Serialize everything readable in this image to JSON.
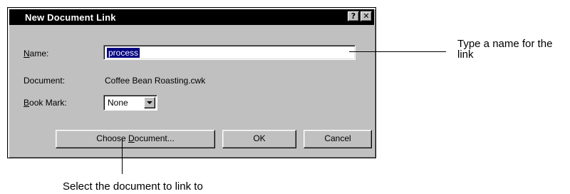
{
  "dialog": {
    "title": "New Document Link",
    "help_icon_label": "?",
    "close_icon_label": "✕",
    "name": {
      "label_underlined": "N",
      "label_rest": "ame:",
      "value": "process"
    },
    "document": {
      "label": "Document:",
      "value": "Coffee Bean Roasting.cwk"
    },
    "bookmark": {
      "label_underlined": "B",
      "label_rest": "ook Mark:",
      "selected": "None"
    },
    "buttons": {
      "choose_pre": "Choose ",
      "choose_underlined": "D",
      "choose_post": "ocument...",
      "ok": "OK",
      "cancel": "Cancel"
    }
  },
  "callouts": {
    "name_hint": "Type a name for the link",
    "choose_hint": "Select the document to link to"
  }
}
